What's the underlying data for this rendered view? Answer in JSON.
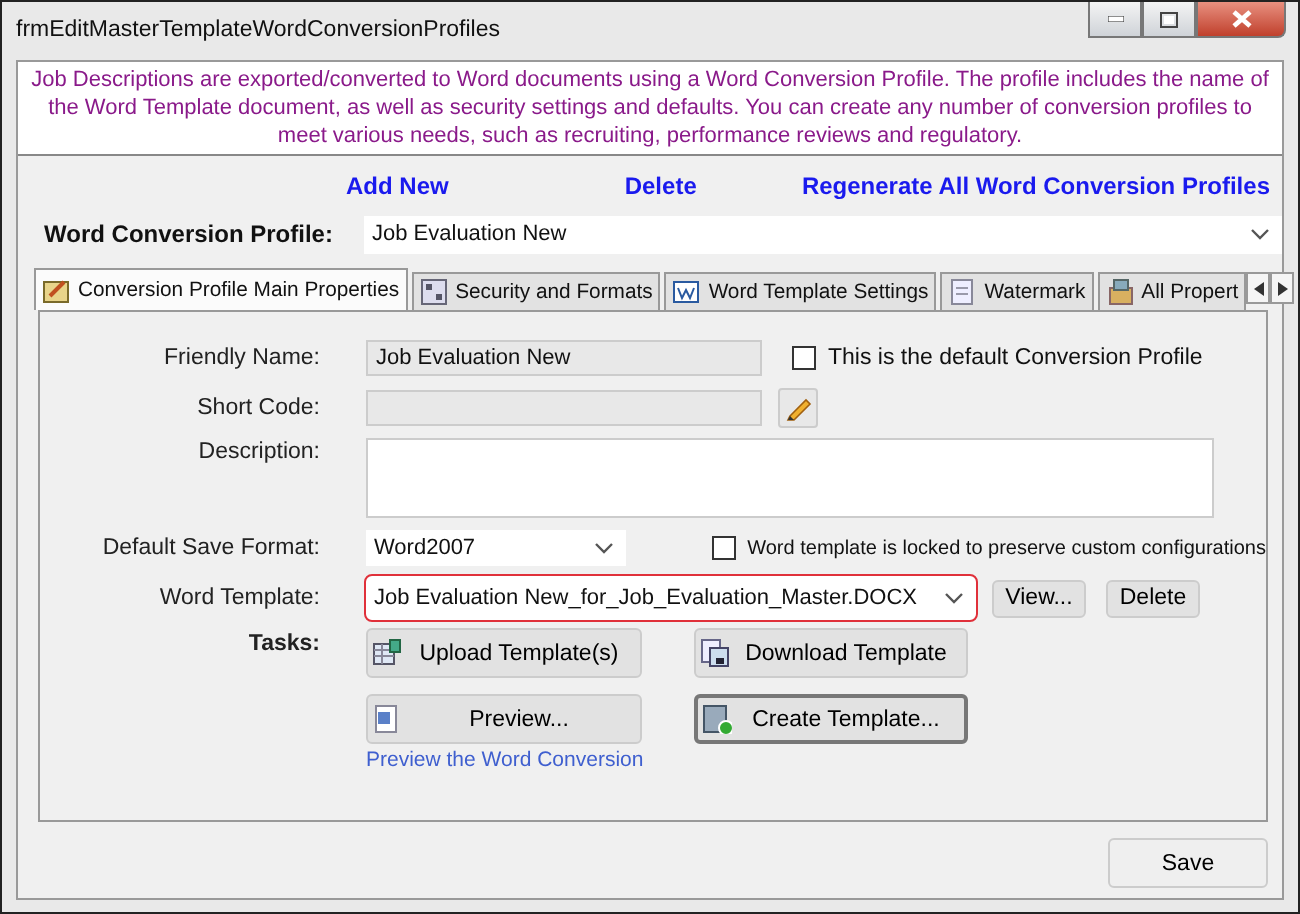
{
  "window": {
    "title": "frmEditMasterTemplateWordConversionProfiles"
  },
  "info_text": "Job Descriptions are exported/converted to Word documents using a Word Conversion Profile. The profile includes the name of the Word Template document, as well as security settings and defaults.  You can create any number of conversion profiles to meet various needs, such as recruiting, performance reviews and regulatory.",
  "actions": [
    "Add New",
    "Delete",
    "Regenerate All Word Conversion Profiles"
  ],
  "profile": {
    "label": "Word Conversion Profile:",
    "value": "Job Evaluation New"
  },
  "tabs": [
    {
      "label": "Conversion Profile Main Properties",
      "selected": true
    },
    {
      "label": "Security and Formats",
      "selected": false
    },
    {
      "label": "Word Template Settings",
      "selected": false
    },
    {
      "label": "Watermark",
      "selected": false
    },
    {
      "label": "All Propert",
      "selected": false
    }
  ],
  "form": {
    "friendly_name": {
      "label": "Friendly Name:",
      "value": "Job Evaluation New"
    },
    "default_checkbox": {
      "label": "This is the default Conversion Profile",
      "checked": false
    },
    "short_code": {
      "label": "Short Code:"
    },
    "description": {
      "label": "Description:"
    },
    "save_format": {
      "label": "Default Save Format:",
      "value": "Word2007"
    },
    "locked_checkbox": {
      "label": "Word template is locked to preserve custom configurations",
      "checked": false
    },
    "word_template": {
      "label": "Word Template:",
      "value": "Job Evaluation New_for_Job_Evaluation_Master.DOCX",
      "highlighted": true
    },
    "template_buttons": [
      "View...",
      "Delete"
    ],
    "tasks_label": "Tasks:",
    "tasks": [
      {
        "label": "Upload Template(s)",
        "focused": false
      },
      {
        "label": "Download Template",
        "focused": false
      },
      {
        "label": "Preview...",
        "focused": false
      },
      {
        "label": "Create Template...",
        "focused": true
      }
    ],
    "preview_link": "Preview the Word Conversion"
  },
  "save_button": "Save"
}
